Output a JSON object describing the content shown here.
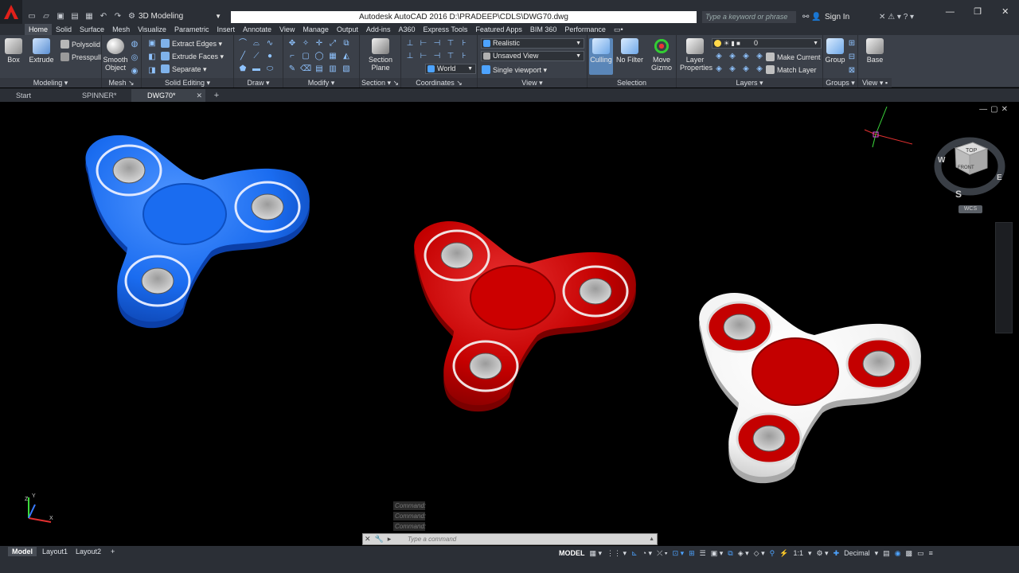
{
  "app": {
    "title": "Autodesk AutoCAD 2016   D:\\PRADEEP\\CDLS\\DWG70.dwg",
    "workspace": "3D Modeling",
    "search_placeholder": "Type a keyword or phrase",
    "sign_in": "Sign In"
  },
  "ribbon_tabs": [
    "Home",
    "Solid",
    "Surface",
    "Mesh",
    "Visualize",
    "Parametric",
    "Insert",
    "Annotate",
    "View",
    "Manage",
    "Output",
    "Add-ins",
    "A360",
    "Express Tools",
    "Featured Apps",
    "BIM 360",
    "Performance"
  ],
  "panels": {
    "modeling": {
      "title": "Modeling",
      "box": "Box",
      "extrude": "Extrude",
      "polysolid": "Polysolid",
      "presspull": "Presspull"
    },
    "mesh": {
      "title": "Mesh",
      "smooth_object": "Smooth Object"
    },
    "solid_editing": {
      "title": "Solid Editing",
      "extract_edges": "Extract Edges",
      "extrude_faces": "Extrude Faces",
      "separate": "Separate"
    },
    "draw": {
      "title": "Draw"
    },
    "modify": {
      "title": "Modify"
    },
    "section": {
      "title": "Section",
      "section_plane": "Section Plane"
    },
    "coordinates": {
      "title": "Coordinates",
      "world": "World"
    },
    "view": {
      "title": "View",
      "visual_style": "Realistic",
      "named_view": "Unsaved View",
      "viewport": "Single viewport"
    },
    "selection": {
      "title": "Selection",
      "culling": "Culling",
      "no_filter": "No Filter",
      "move_gizmo": "Move Gizmo"
    },
    "layers": {
      "title": "Layers",
      "layer_properties": "Layer Properties",
      "layer_value": "0",
      "make_current": "Make Current",
      "match_layer": "Match Layer"
    },
    "groups": {
      "title": "Groups",
      "group": "Group"
    },
    "view2": {
      "title": "View",
      "base": "Base"
    }
  },
  "file_tabs": [
    "Start",
    "SPINNER*",
    "DWG70*"
  ],
  "viewcube": {
    "top": "TOP",
    "front": "FRONT",
    "n": "W",
    "e": "E",
    "s": "S",
    "wcs": "WCS"
  },
  "command": {
    "history": [
      "Command:",
      "Command:",
      "Command:"
    ],
    "placeholder": "Type a command"
  },
  "layouts": [
    "Model",
    "Layout1",
    "Layout2"
  ],
  "status": {
    "model": "MODEL",
    "scale": "1:1",
    "units": "Decimal"
  },
  "colors": {
    "blue_spinner": "#1a6cf0",
    "red_spinner": "#c40000",
    "white_spinner": "#f2f2f2",
    "accent": "#4da3ff"
  }
}
